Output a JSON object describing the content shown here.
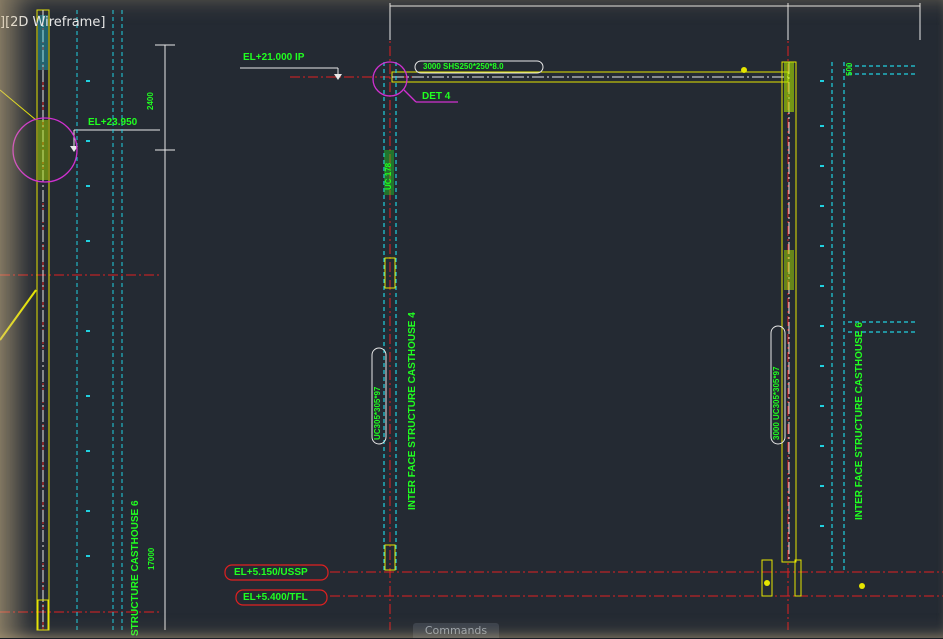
{
  "viewport": {
    "label": "][2D Wireframe]"
  },
  "command_bar": {
    "label": "Commands"
  },
  "annotations": {
    "el_top": "EL+21.000 IP",
    "el_mid": "EL+23.950",
    "det": "DET 4",
    "beam_tag": "3000 SHS250*250*8.0",
    "el_floor1": "EL+5.150/USSP",
    "el_floor2": "EL+5.400/TFL",
    "dim_2400": "2400",
    "dim_500": "500"
  },
  "vertical_labels": {
    "interface_4": "INTER FACE STRUCTURE CASTHOUSE 4",
    "interface_6_right": "INTER FACE STRUCTURE CASTHOUSE 6",
    "interface_6_left": "STRUCTURE CASTHOUSE 6",
    "dim_17000": "17000",
    "col_tag_left": "UC305*305*97",
    "col_tag_right": "3000 UC305*305*97",
    "col_tag_top": "UC 178"
  },
  "colors": {
    "background": "#242a33",
    "text_green": "#20ff20",
    "member_yellow": "#e6e600",
    "axis_red": "#e02020",
    "dim_white": "#e8e8e8",
    "detail_magenta": "#d030d0",
    "hidden_cyan": "#20d0e0"
  }
}
